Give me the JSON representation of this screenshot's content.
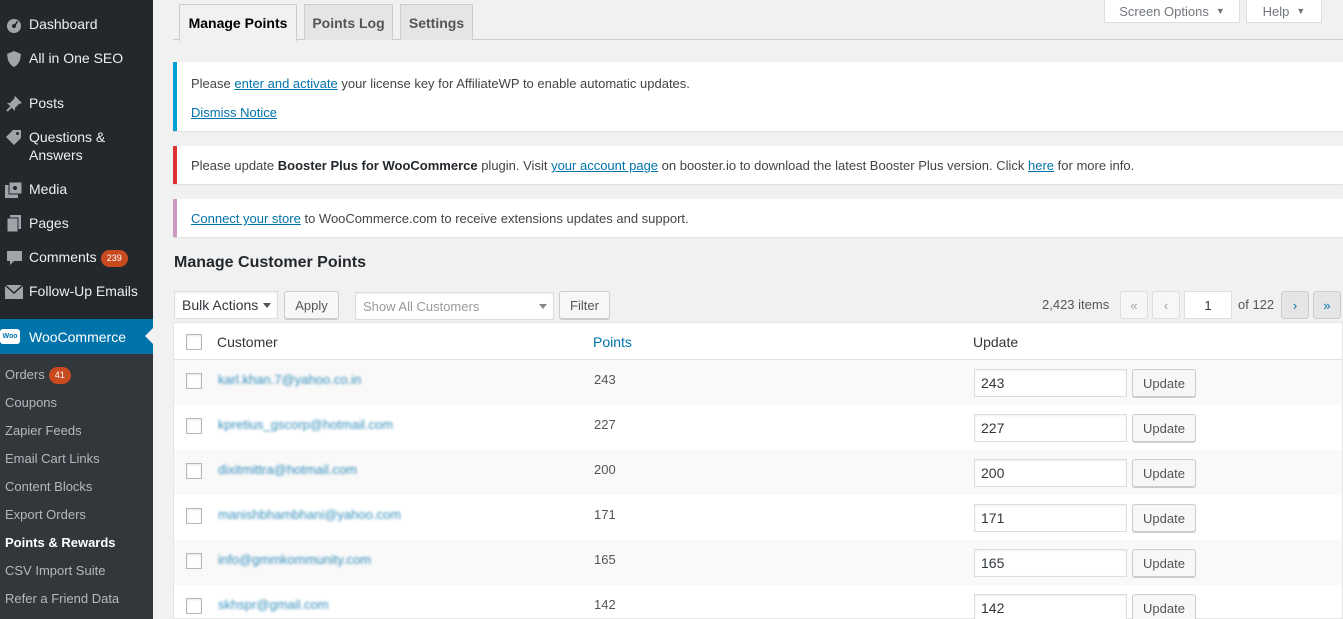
{
  "sidebar": {
    "items": [
      {
        "label": "Dashboard",
        "icon": "dashboard-icon"
      },
      {
        "label": "All in One SEO",
        "icon": "shield-icon"
      },
      {
        "label": "Posts",
        "icon": "pin-icon"
      },
      {
        "label": "Questions &",
        "label2": "Answers",
        "icon": "tag-icon"
      },
      {
        "label": "Media",
        "icon": "media-icon"
      },
      {
        "label": "Pages",
        "icon": "pages-icon"
      },
      {
        "label": "Comments",
        "badge": "239",
        "icon": "comment-icon"
      },
      {
        "label": "Follow-Up Emails",
        "icon": "email-icon"
      }
    ],
    "woocommerce": {
      "label": "WooCommerce",
      "logo": "Woo"
    },
    "submenu": [
      {
        "label": "Orders",
        "badge": "41"
      },
      {
        "label": "Coupons"
      },
      {
        "label": "Zapier Feeds"
      },
      {
        "label": "Email Cart Links"
      },
      {
        "label": "Content Blocks"
      },
      {
        "label": "Export Orders"
      },
      {
        "label": "Points & Rewards",
        "current": true
      },
      {
        "label": "CSV Import Suite"
      },
      {
        "label": "Refer a Friend Data"
      }
    ]
  },
  "tabs": [
    "Manage Points",
    "Points Log",
    "Settings"
  ],
  "screen_options": {
    "screen": "Screen Options",
    "help": "Help"
  },
  "notices": {
    "license": {
      "pre": "Please ",
      "link": "enter and activate",
      "post": " your license key for AffiliateWP to enable automatic updates.",
      "dismiss": "Dismiss Notice"
    },
    "booster": {
      "pre": "Please update ",
      "bold": "Booster Plus for WooCommerce",
      "mid1": " plugin. Visit ",
      "link1": "your account page",
      "mid2": " on booster.io to download the latest Booster Plus version. Click ",
      "link2": "here",
      "post": " for more info."
    },
    "connect": {
      "link": "Connect your store",
      "post": " to WooCommerce.com to receive extensions updates and support."
    }
  },
  "section_title": "Manage Customer Points",
  "toolbar": {
    "bulk_actions": "Bulk Actions",
    "apply": "Apply",
    "customer_placeholder": "Show All Customers",
    "filter": "Filter"
  },
  "pagination": {
    "items": "2,423 items",
    "first": "«",
    "prev": "‹",
    "current_page": "1",
    "of": "of 122",
    "next": "›",
    "last": "»"
  },
  "table": {
    "headers": {
      "customer": "Customer",
      "points": "Points",
      "update": "Update"
    },
    "update_label": "Update",
    "rows": [
      {
        "customer": "karl.khan.7@yahoo.co.in",
        "points": "243",
        "value": "243"
      },
      {
        "customer": "kpretius_gscorp@hotmail.com",
        "points": "227",
        "value": "227"
      },
      {
        "customer": "dixitmittra@hotmail.com",
        "points": "200",
        "value": "200"
      },
      {
        "customer": "manishbhambhani@yahoo.com",
        "points": "171",
        "value": "171"
      },
      {
        "customer": "info@gmmkommunity.com",
        "points": "165",
        "value": "165"
      },
      {
        "customer": "skhspr@gmail.com",
        "points": "142",
        "value": "142"
      }
    ]
  },
  "colors": {
    "sidebar_bg": "#23282d",
    "submenu_bg": "#32373c",
    "accent": "#0073aa",
    "badge": "#ca4a1f",
    "notice_info": "#00a0d2",
    "notice_error": "#dc3232",
    "notice_woo": "#cc99c2"
  }
}
